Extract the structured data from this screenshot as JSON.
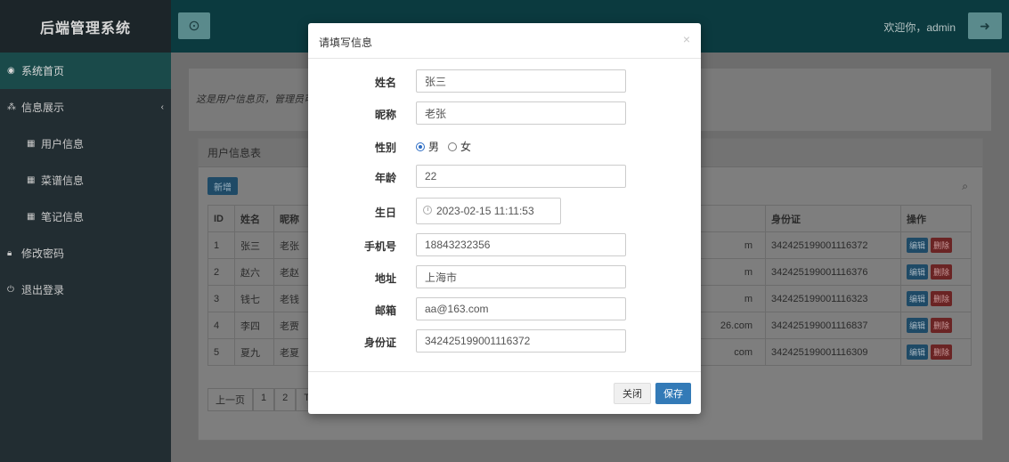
{
  "sidebar": {
    "brand": "后端管理系统",
    "items": [
      {
        "icon": "dashboard-icon",
        "label": "系统首页"
      },
      {
        "icon": "sitemap-icon",
        "label": "信息展示"
      },
      {
        "icon": "table-icon",
        "label": "用户信息"
      },
      {
        "icon": "table-icon",
        "label": "菜谱信息"
      },
      {
        "icon": "table-icon",
        "label": "笔记信息"
      },
      {
        "icon": "lock-icon",
        "label": "修改密码"
      },
      {
        "icon": "power-icon",
        "label": "退出登录"
      }
    ]
  },
  "header": {
    "welcome": "欢迎你，admin"
  },
  "main": {
    "intro": "这是用户信息页，管理员可",
    "table_title": "用户信息表",
    "add_label": "新增",
    "columns": [
      "ID",
      "姓名",
      "昵称",
      "身份证",
      "操作"
    ],
    "rows": [
      {
        "id": "1",
        "name": "张三",
        "nick": "老张",
        "email_tail": "m",
        "idcard": "342425199001116372"
      },
      {
        "id": "2",
        "name": "赵六",
        "nick": "老赵",
        "email_tail": "m",
        "idcard": "342425199001116376"
      },
      {
        "id": "3",
        "name": "钱七",
        "nick": "老钱",
        "email_tail": "m",
        "idcard": "342425199001116323"
      },
      {
        "id": "4",
        "name": "李四",
        "nick": "老贾",
        "email_tail": "26.com",
        "idcard": "342425199001116837"
      },
      {
        "id": "5",
        "name": "夏九",
        "nick": "老夏",
        "email_tail": "com",
        "idcard": "342425199001116309"
      }
    ],
    "edit_label": "编辑",
    "delete_label": "删除",
    "pager": [
      "上一页",
      "1",
      "2",
      "T"
    ]
  },
  "modal": {
    "title": "请填写信息",
    "close_glyph": "×",
    "fields": {
      "name": {
        "label": "姓名",
        "value": "张三"
      },
      "nickname": {
        "label": "昵称",
        "value": "老张"
      },
      "gender": {
        "label": "性别",
        "options": [
          "男",
          "女"
        ],
        "selected": "男"
      },
      "age": {
        "label": "年龄",
        "value": "22"
      },
      "birthday": {
        "label": "生日",
        "value": "2023-02-15 11:11:53"
      },
      "phone": {
        "label": "手机号",
        "value": "18843232356"
      },
      "address": {
        "label": "地址",
        "value": "上海市"
      },
      "email": {
        "label": "邮箱",
        "value": "aa@163.com"
      },
      "idcard": {
        "label": "身份证",
        "value": "342425199001116372"
      }
    },
    "close_label": "关闭",
    "save_label": "保存"
  },
  "colors": {
    "sidebar_bg": "#222d32",
    "topbar_bg": "#0b3a3f",
    "primary": "#337ab7"
  }
}
